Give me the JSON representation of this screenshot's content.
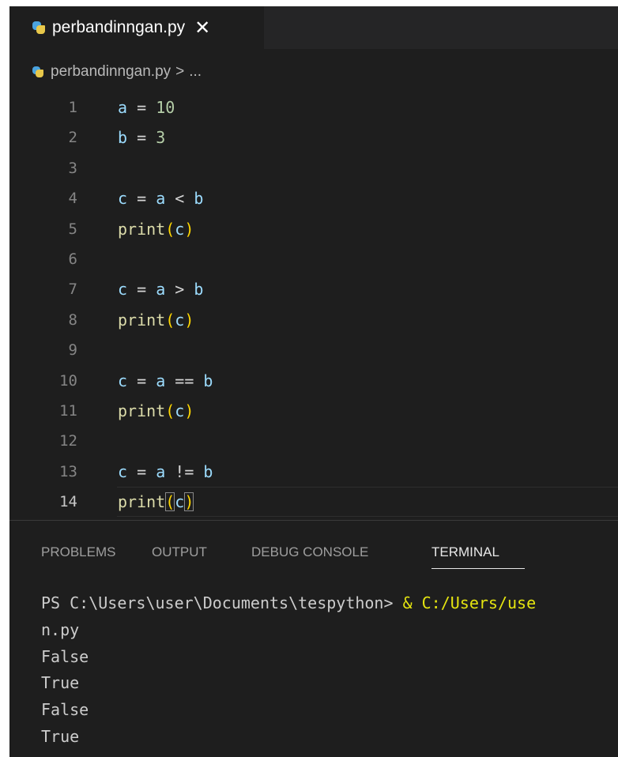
{
  "tab": {
    "filename": "perbandinngan.py",
    "close": "✕",
    "icon": "python-file-icon"
  },
  "breadcrumb": {
    "filename": "perbandinngan.py",
    "separator": ">",
    "more": "..."
  },
  "editor": {
    "current_line": 14,
    "lines": [
      {
        "num": "1"
      },
      {
        "num": "2"
      },
      {
        "num": "3"
      },
      {
        "num": "4"
      },
      {
        "num": "5"
      },
      {
        "num": "6"
      },
      {
        "num": "7"
      },
      {
        "num": "8"
      },
      {
        "num": "9"
      },
      {
        "num": "10"
      },
      {
        "num": "11"
      },
      {
        "num": "12"
      },
      {
        "num": "13"
      },
      {
        "num": "14"
      }
    ],
    "tokens": {
      "a": "a",
      "b": "b",
      "c": "c",
      "eq": "=",
      "ten": "10",
      "three": "3",
      "lt": "<",
      "gt": ">",
      "eqeq": "==",
      "neq": "!=",
      "print": "print",
      "lparen": "(",
      "rparen": ")"
    }
  },
  "panel": {
    "tabs": [
      "PROBLEMS",
      "OUTPUT",
      "DEBUG CONSOLE",
      "TERMINAL"
    ],
    "active_tab": "TERMINAL"
  },
  "terminal": {
    "prompt": "PS C:\\Users\\user\\Documents\\tespython> ",
    "command": "& C:/Users/use",
    "lines": [
      "n.py",
      "False",
      "True",
      "False",
      "True"
    ]
  },
  "colors": {
    "background": "#1e1e1e",
    "variable": "#9cdcfe",
    "number": "#b5cea8",
    "function": "#dcdcaa",
    "bracket": "#ffd700",
    "terminal_command": "#e5e510"
  }
}
